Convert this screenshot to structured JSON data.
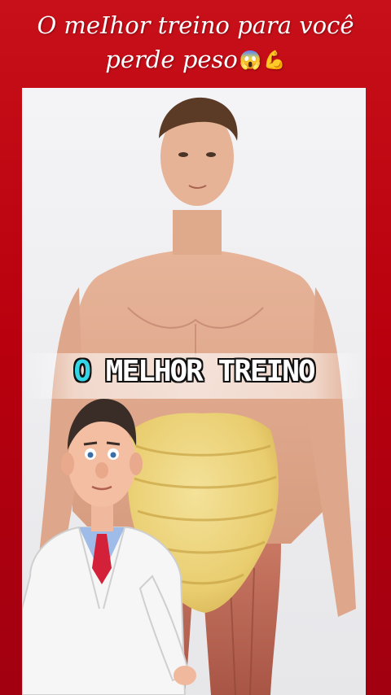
{
  "header": {
    "line1": "O meIhor treino para você",
    "line2": "perde peso",
    "emoji1": "😱",
    "emoji2": "💪"
  },
  "video": {
    "caption_word1": "O",
    "caption_rest": "MELHOR TREINO",
    "caption_highlight_color": "#33d6e6",
    "background_color": "#c8101a"
  },
  "icons": [
    "shocked-face-emoji",
    "flexed-biceps-emoji"
  ]
}
